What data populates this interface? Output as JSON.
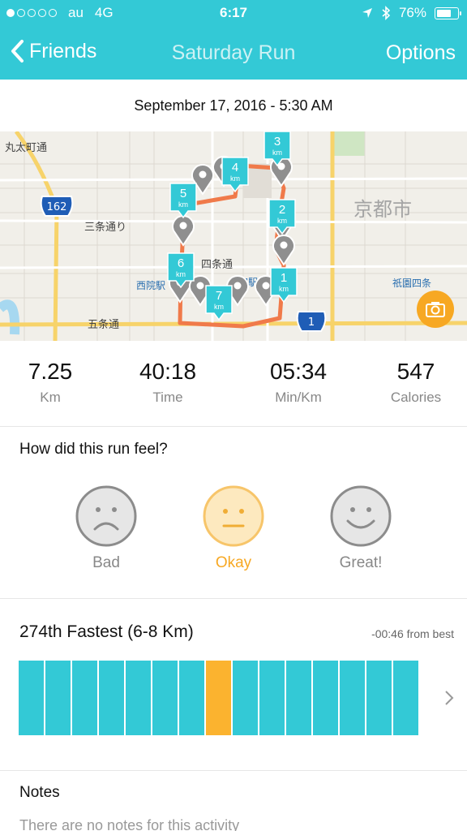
{
  "status": {
    "carrier": "au",
    "network": "4G",
    "time": "6:17",
    "battery": "76%",
    "battery_level": 0.76
  },
  "nav": {
    "back_label": "Friends",
    "title": "Saturday Run",
    "options_label": "Options"
  },
  "date": "September 17, 2016 - 5:30 AM",
  "map": {
    "labels": [
      "丸太町通",
      "三条通り",
      "四条通",
      "京都市",
      "西院駅",
      "大宮駅",
      "祇園四条",
      "五条通",
      "162",
      "1"
    ],
    "km_markers": [
      "1",
      "2",
      "3",
      "4",
      "5",
      "6",
      "7"
    ],
    "km_unit": "km",
    "route_color": "#f07a4a"
  },
  "stats": [
    {
      "value": "7.25",
      "label": "Km"
    },
    {
      "value": "40:18",
      "label": "Time"
    },
    {
      "value": "05:34",
      "label": "Min/Km"
    },
    {
      "value": "547",
      "label": "Calories"
    }
  ],
  "feel": {
    "question": "How did this run feel?",
    "options": [
      {
        "label": "Bad"
      },
      {
        "label": "Okay"
      },
      {
        "label": "Great!"
      }
    ],
    "selected": "Okay",
    "accent": "#f7a823"
  },
  "rank": {
    "title": "274th Fastest (6-8 Km)",
    "subtitle": "-00:46 from best",
    "bar_count": 15,
    "highlight_index": 7,
    "bar_color": "#33c9d6",
    "highlight_color": "#fbb32f"
  },
  "notes": {
    "heading": "Notes",
    "text": "There are no notes for this activity"
  },
  "colors": {
    "brand": "#33c9d6",
    "accent": "#f7a823"
  }
}
